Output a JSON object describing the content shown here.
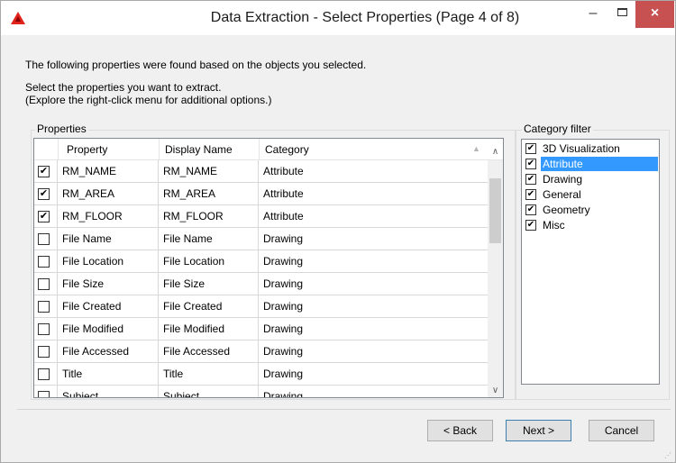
{
  "window": {
    "title": "Data Extraction - Select Properties (Page 4 of 8)",
    "minimize": "–",
    "close": "×",
    "accent": "#c75050"
  },
  "intro": {
    "line1": "The following properties were found based on the objects you selected.",
    "line2": "Select the properties you want to extract.",
    "line3": "(Explore the right-click menu for additional options.)"
  },
  "properties": {
    "group_label": "Properties",
    "columns": [
      "Property",
      "Display Name",
      "Category"
    ],
    "rows": [
      {
        "checked": true,
        "property": "RM_NAME",
        "display": "RM_NAME",
        "category": "Attribute"
      },
      {
        "checked": true,
        "property": "RM_AREA",
        "display": "RM_AREA",
        "category": "Attribute"
      },
      {
        "checked": true,
        "property": "RM_FLOOR",
        "display": "RM_FLOOR",
        "category": "Attribute"
      },
      {
        "checked": false,
        "property": "File Name",
        "display": "File Name",
        "category": "Drawing"
      },
      {
        "checked": false,
        "property": "File Location",
        "display": "File Location",
        "category": "Drawing"
      },
      {
        "checked": false,
        "property": "File Size",
        "display": "File Size",
        "category": "Drawing"
      },
      {
        "checked": false,
        "property": "File Created",
        "display": "File Created",
        "category": "Drawing"
      },
      {
        "checked": false,
        "property": "File Modified",
        "display": "File Modified",
        "category": "Drawing"
      },
      {
        "checked": false,
        "property": "File Accessed",
        "display": "File Accessed",
        "category": "Drawing"
      },
      {
        "checked": false,
        "property": "Title",
        "display": "Title",
        "category": "Drawing"
      },
      {
        "checked": false,
        "property": "Subject",
        "display": "Subject",
        "category": "Drawing"
      }
    ]
  },
  "category_filter": {
    "group_label": "Category filter",
    "items": [
      {
        "label": "3D Visualization",
        "checked": true,
        "selected": false
      },
      {
        "label": "Attribute",
        "checked": true,
        "selected": true
      },
      {
        "label": "Drawing",
        "checked": true,
        "selected": false
      },
      {
        "label": "General",
        "checked": true,
        "selected": false
      },
      {
        "label": "Geometry",
        "checked": true,
        "selected": false
      },
      {
        "label": "Misc",
        "checked": true,
        "selected": false
      }
    ]
  },
  "buttons": {
    "back": "< Back",
    "next": "Next >",
    "cancel": "Cancel"
  },
  "check_glyph": "✔"
}
